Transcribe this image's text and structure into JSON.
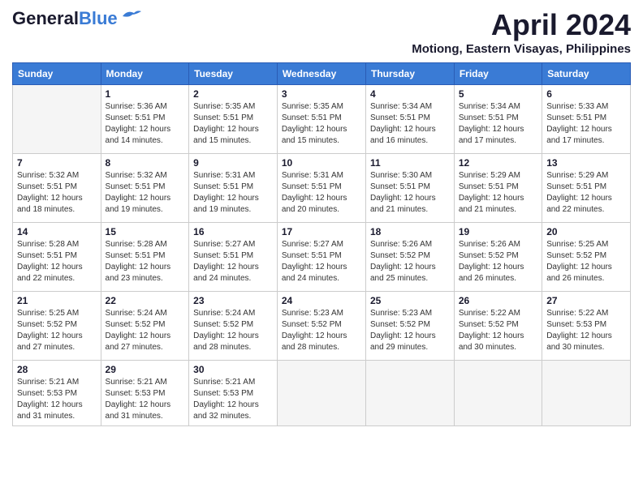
{
  "logo": {
    "line1": "General",
    "line2": "Blue"
  },
  "title": "April 2024",
  "location": "Motiong, Eastern Visayas, Philippines",
  "days_of_week": [
    "Sunday",
    "Monday",
    "Tuesday",
    "Wednesday",
    "Thursday",
    "Friday",
    "Saturday"
  ],
  "weeks": [
    [
      {
        "num": "",
        "info": ""
      },
      {
        "num": "1",
        "info": "Sunrise: 5:36 AM\nSunset: 5:51 PM\nDaylight: 12 hours\nand 14 minutes."
      },
      {
        "num": "2",
        "info": "Sunrise: 5:35 AM\nSunset: 5:51 PM\nDaylight: 12 hours\nand 15 minutes."
      },
      {
        "num": "3",
        "info": "Sunrise: 5:35 AM\nSunset: 5:51 PM\nDaylight: 12 hours\nand 15 minutes."
      },
      {
        "num": "4",
        "info": "Sunrise: 5:34 AM\nSunset: 5:51 PM\nDaylight: 12 hours\nand 16 minutes."
      },
      {
        "num": "5",
        "info": "Sunrise: 5:34 AM\nSunset: 5:51 PM\nDaylight: 12 hours\nand 17 minutes."
      },
      {
        "num": "6",
        "info": "Sunrise: 5:33 AM\nSunset: 5:51 PM\nDaylight: 12 hours\nand 17 minutes."
      }
    ],
    [
      {
        "num": "7",
        "info": "Sunrise: 5:32 AM\nSunset: 5:51 PM\nDaylight: 12 hours\nand 18 minutes."
      },
      {
        "num": "8",
        "info": "Sunrise: 5:32 AM\nSunset: 5:51 PM\nDaylight: 12 hours\nand 19 minutes."
      },
      {
        "num": "9",
        "info": "Sunrise: 5:31 AM\nSunset: 5:51 PM\nDaylight: 12 hours\nand 19 minutes."
      },
      {
        "num": "10",
        "info": "Sunrise: 5:31 AM\nSunset: 5:51 PM\nDaylight: 12 hours\nand 20 minutes."
      },
      {
        "num": "11",
        "info": "Sunrise: 5:30 AM\nSunset: 5:51 PM\nDaylight: 12 hours\nand 21 minutes."
      },
      {
        "num": "12",
        "info": "Sunrise: 5:29 AM\nSunset: 5:51 PM\nDaylight: 12 hours\nand 21 minutes."
      },
      {
        "num": "13",
        "info": "Sunrise: 5:29 AM\nSunset: 5:51 PM\nDaylight: 12 hours\nand 22 minutes."
      }
    ],
    [
      {
        "num": "14",
        "info": "Sunrise: 5:28 AM\nSunset: 5:51 PM\nDaylight: 12 hours\nand 22 minutes."
      },
      {
        "num": "15",
        "info": "Sunrise: 5:28 AM\nSunset: 5:51 PM\nDaylight: 12 hours\nand 23 minutes."
      },
      {
        "num": "16",
        "info": "Sunrise: 5:27 AM\nSunset: 5:51 PM\nDaylight: 12 hours\nand 24 minutes."
      },
      {
        "num": "17",
        "info": "Sunrise: 5:27 AM\nSunset: 5:51 PM\nDaylight: 12 hours\nand 24 minutes."
      },
      {
        "num": "18",
        "info": "Sunrise: 5:26 AM\nSunset: 5:52 PM\nDaylight: 12 hours\nand 25 minutes."
      },
      {
        "num": "19",
        "info": "Sunrise: 5:26 AM\nSunset: 5:52 PM\nDaylight: 12 hours\nand 26 minutes."
      },
      {
        "num": "20",
        "info": "Sunrise: 5:25 AM\nSunset: 5:52 PM\nDaylight: 12 hours\nand 26 minutes."
      }
    ],
    [
      {
        "num": "21",
        "info": "Sunrise: 5:25 AM\nSunset: 5:52 PM\nDaylight: 12 hours\nand 27 minutes."
      },
      {
        "num": "22",
        "info": "Sunrise: 5:24 AM\nSunset: 5:52 PM\nDaylight: 12 hours\nand 27 minutes."
      },
      {
        "num": "23",
        "info": "Sunrise: 5:24 AM\nSunset: 5:52 PM\nDaylight: 12 hours\nand 28 minutes."
      },
      {
        "num": "24",
        "info": "Sunrise: 5:23 AM\nSunset: 5:52 PM\nDaylight: 12 hours\nand 28 minutes."
      },
      {
        "num": "25",
        "info": "Sunrise: 5:23 AM\nSunset: 5:52 PM\nDaylight: 12 hours\nand 29 minutes."
      },
      {
        "num": "26",
        "info": "Sunrise: 5:22 AM\nSunset: 5:52 PM\nDaylight: 12 hours\nand 30 minutes."
      },
      {
        "num": "27",
        "info": "Sunrise: 5:22 AM\nSunset: 5:53 PM\nDaylight: 12 hours\nand 30 minutes."
      }
    ],
    [
      {
        "num": "28",
        "info": "Sunrise: 5:21 AM\nSunset: 5:53 PM\nDaylight: 12 hours\nand 31 minutes."
      },
      {
        "num": "29",
        "info": "Sunrise: 5:21 AM\nSunset: 5:53 PM\nDaylight: 12 hours\nand 31 minutes."
      },
      {
        "num": "30",
        "info": "Sunrise: 5:21 AM\nSunset: 5:53 PM\nDaylight: 12 hours\nand 32 minutes."
      },
      {
        "num": "",
        "info": ""
      },
      {
        "num": "",
        "info": ""
      },
      {
        "num": "",
        "info": ""
      },
      {
        "num": "",
        "info": ""
      }
    ]
  ]
}
